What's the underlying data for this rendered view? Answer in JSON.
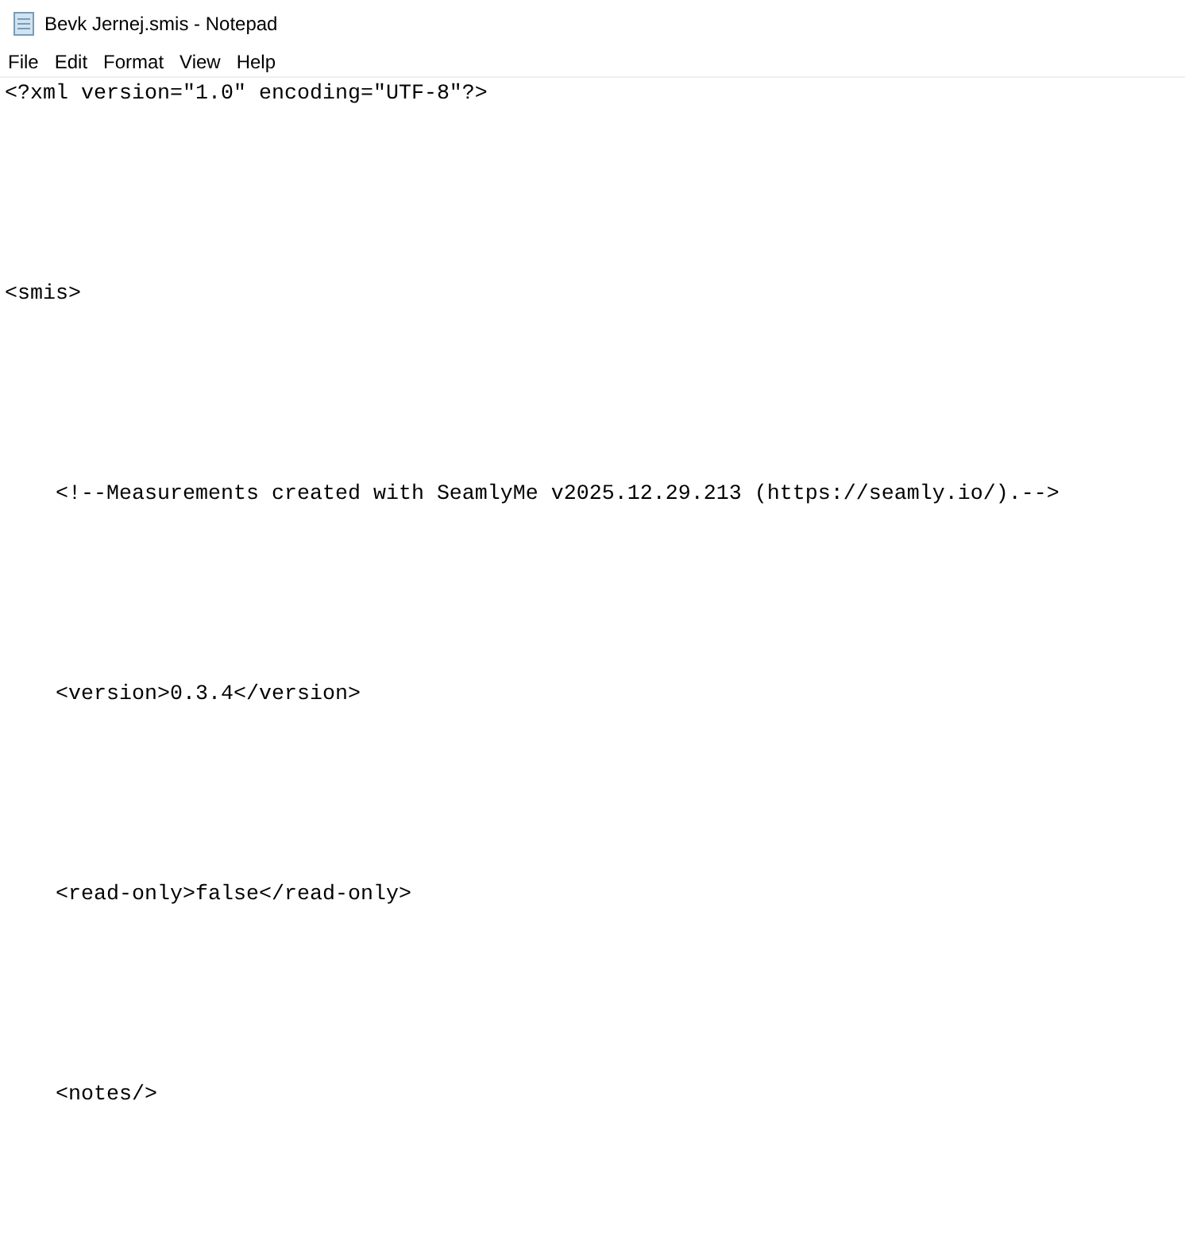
{
  "window": {
    "title": "Bevk Jernej.smis - Notepad"
  },
  "menu": [
    "File",
    "Edit",
    "Format",
    "View",
    "Help"
  ],
  "editor": {
    "lines": [
      "<?xml version=\"1.0\" encoding=\"UTF-8\"?>",
      "<smis>",
      "    <!--Measurements created with SeamlyMe v2025.12.29.213 (https://seamly.io/).-->",
      "    <version>0.3.4</version>",
      "    <read-only>false</read-only>",
      "    <notes/>"
    ]
  }
}
